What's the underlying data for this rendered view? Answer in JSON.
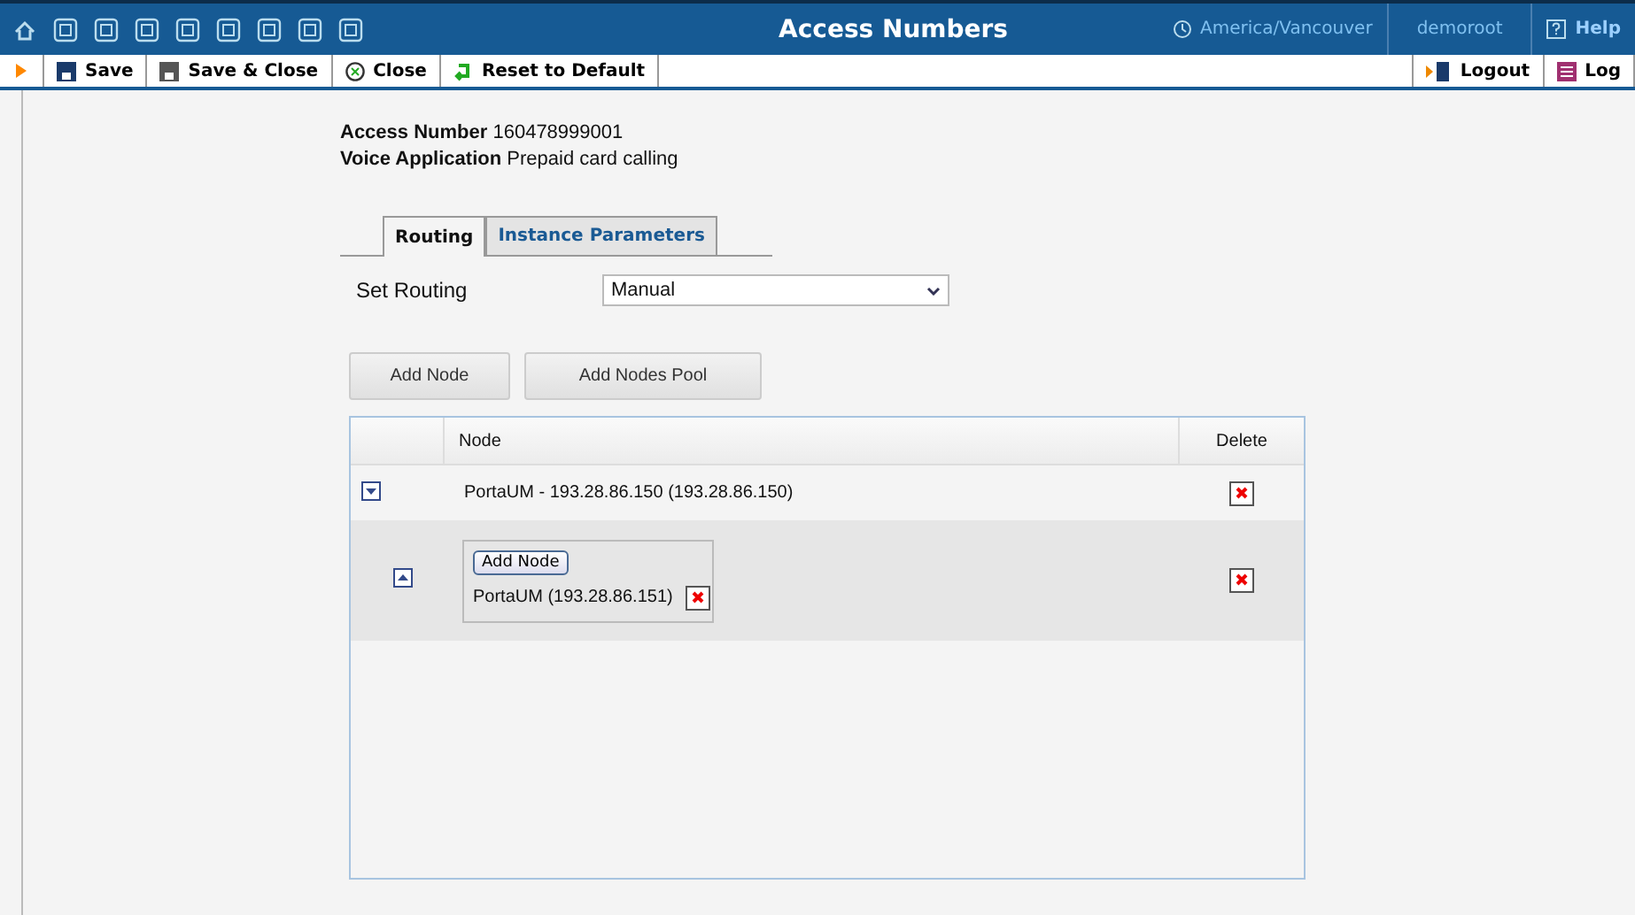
{
  "header": {
    "title": "Access Numbers",
    "timezone": "America/Vancouver",
    "user": "demoroot",
    "help": "Help"
  },
  "toolbar": {
    "buttons": [
      {
        "label": "Save",
        "kind": "save"
      },
      {
        "label": "Save & Close",
        "kind": "save_close"
      },
      {
        "label": "Close",
        "kind": "close"
      },
      {
        "label": "Reset to Default",
        "kind": "reset"
      }
    ],
    "right": [
      {
        "label": "Logout",
        "kind": "logout"
      },
      {
        "label": "Log",
        "kind": "log"
      }
    ]
  },
  "details": [
    {
      "label": "Access Number",
      "value": "160478999001"
    },
    {
      "label": "Voice Application",
      "value": "Prepaid card calling"
    }
  ],
  "tabs": [
    {
      "label": "Routing",
      "selected": true
    },
    {
      "label": "Instance Parameters",
      "selected": false
    }
  ],
  "routing": {
    "label": "Set Routing",
    "value": "Manual"
  },
  "actions": [
    "Add Node",
    "Add Nodes Pool"
  ],
  "table": {
    "columns": [
      "Node",
      "Delete"
    ],
    "rows": [
      {
        "kind": "node",
        "expanded": false,
        "name": "PortaUM - 193.28.86.150 (193.28.86.150)"
      },
      {
        "kind": "pool",
        "expanded": true,
        "add_label": "Add Node",
        "nodes": [
          "PortaUM (193.28.86.151)"
        ]
      }
    ]
  }
}
